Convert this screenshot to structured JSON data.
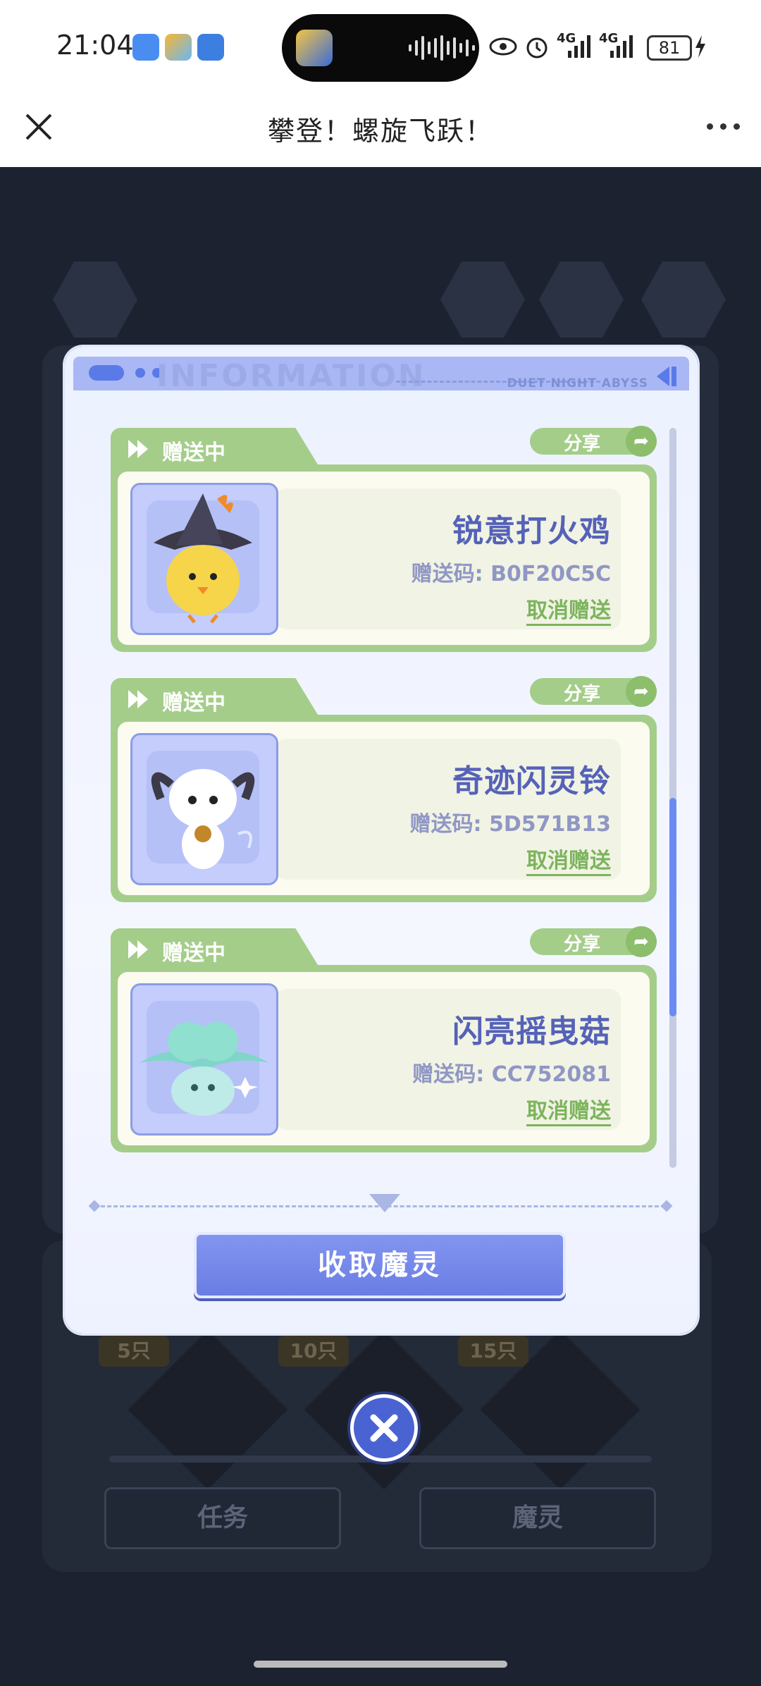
{
  "status_bar": {
    "time": "21:04",
    "network_1": "4G",
    "network_2": "4G",
    "battery": "81"
  },
  "header": {
    "title": "攀登！螺旋飞跃！"
  },
  "modal": {
    "band_ghost_text": "INFORMATION",
    "band_label": "DUET NIGHT ABYSS",
    "items": [
      {
        "status": "赠送中",
        "share_label": "分享",
        "name": "锐意打火鸡",
        "code": "赠送码: B0F20C5C",
        "cancel_label": "取消赠送"
      },
      {
        "status": "赠送中",
        "share_label": "分享",
        "name": "奇迹闪灵铃",
        "code": "赠送码: 5D571B13",
        "cancel_label": "取消赠送"
      },
      {
        "status": "赠送中",
        "share_label": "分享",
        "name": "闪亮摇曳菇",
        "code": "赠送码: CC752081",
        "cancel_label": "取消赠送"
      }
    ],
    "collect_button": "收取魔灵"
  },
  "background": {
    "tags": [
      "5只",
      "10只",
      "15只"
    ],
    "tab_task": "任务",
    "tab_spirit": "魔灵"
  }
}
